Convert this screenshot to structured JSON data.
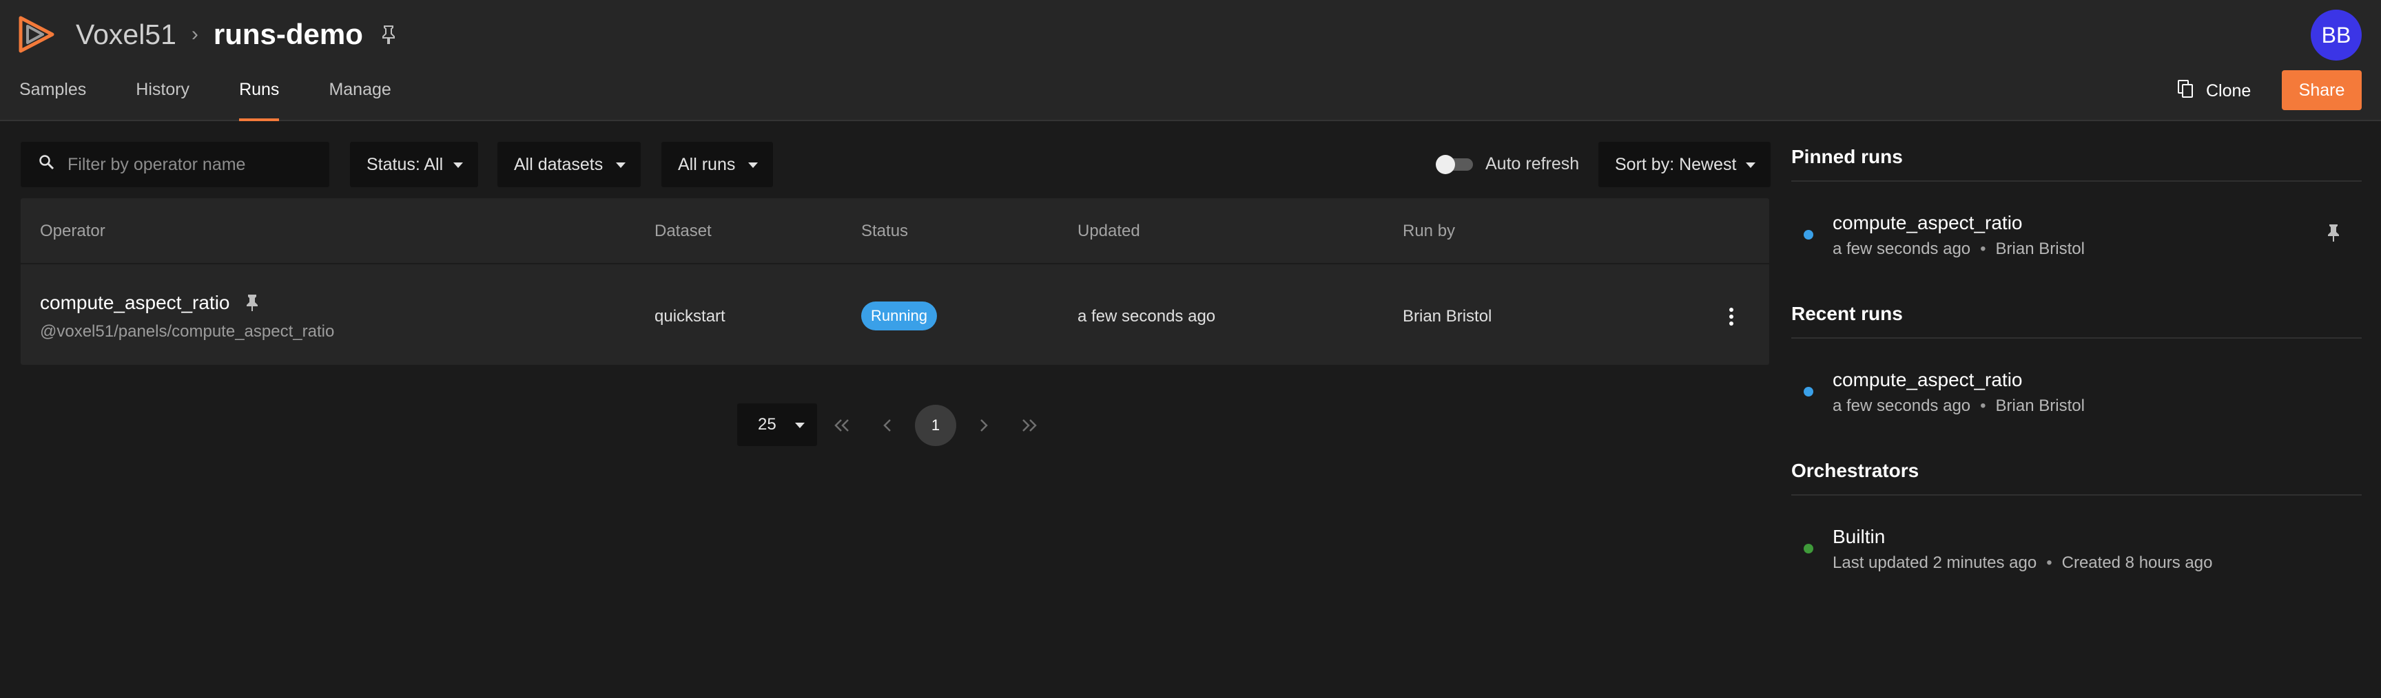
{
  "header": {
    "brand": "Voxel51",
    "separator": "›",
    "dataset": "runs-demo",
    "avatar": "BB",
    "clone_label": "Clone",
    "share_label": "Share",
    "accent": "#f47a3a",
    "avatar_color": "#3b35e6"
  },
  "tabs": [
    {
      "label": "Samples"
    },
    {
      "label": "History"
    },
    {
      "label": "Runs",
      "active": true
    },
    {
      "label": "Manage"
    }
  ],
  "filters": {
    "search_placeholder": "Filter by operator name",
    "status": "Status: All",
    "datasets": "All datasets",
    "runs": "All runs",
    "auto_refresh_label": "Auto refresh",
    "auto_refresh_on": false,
    "sort": "Sort by: Newest"
  },
  "table": {
    "columns": [
      "Operator",
      "Dataset",
      "Status",
      "Updated",
      "Run by"
    ],
    "rows": [
      {
        "operator": "compute_aspect_ratio",
        "uri": "@voxel51/panels/compute_aspect_ratio",
        "dataset": "quickstart",
        "status": "Running",
        "updated": "a few seconds ago",
        "run_by": "Brian Bristol",
        "pinned": true
      }
    ]
  },
  "pagination": {
    "page_size": "25",
    "current_page": "1"
  },
  "sidebar": {
    "pinned_title": "Pinned runs",
    "pinned": [
      {
        "name": "compute_aspect_ratio",
        "time": "a few seconds ago",
        "user": "Brian Bristol",
        "dot": "#3aa0e8"
      }
    ],
    "recent_title": "Recent runs",
    "recent": [
      {
        "name": "compute_aspect_ratio",
        "time": "a few seconds ago",
        "user": "Brian Bristol",
        "dot": "#3aa0e8"
      }
    ],
    "orchestrators_title": "Orchestrators",
    "orchestrators": [
      {
        "name": "Builtin",
        "updated": "Last updated 2 minutes ago",
        "created": "Created 8 hours ago",
        "dot": "#3f9a3a"
      }
    ],
    "meta_separator": "•"
  }
}
